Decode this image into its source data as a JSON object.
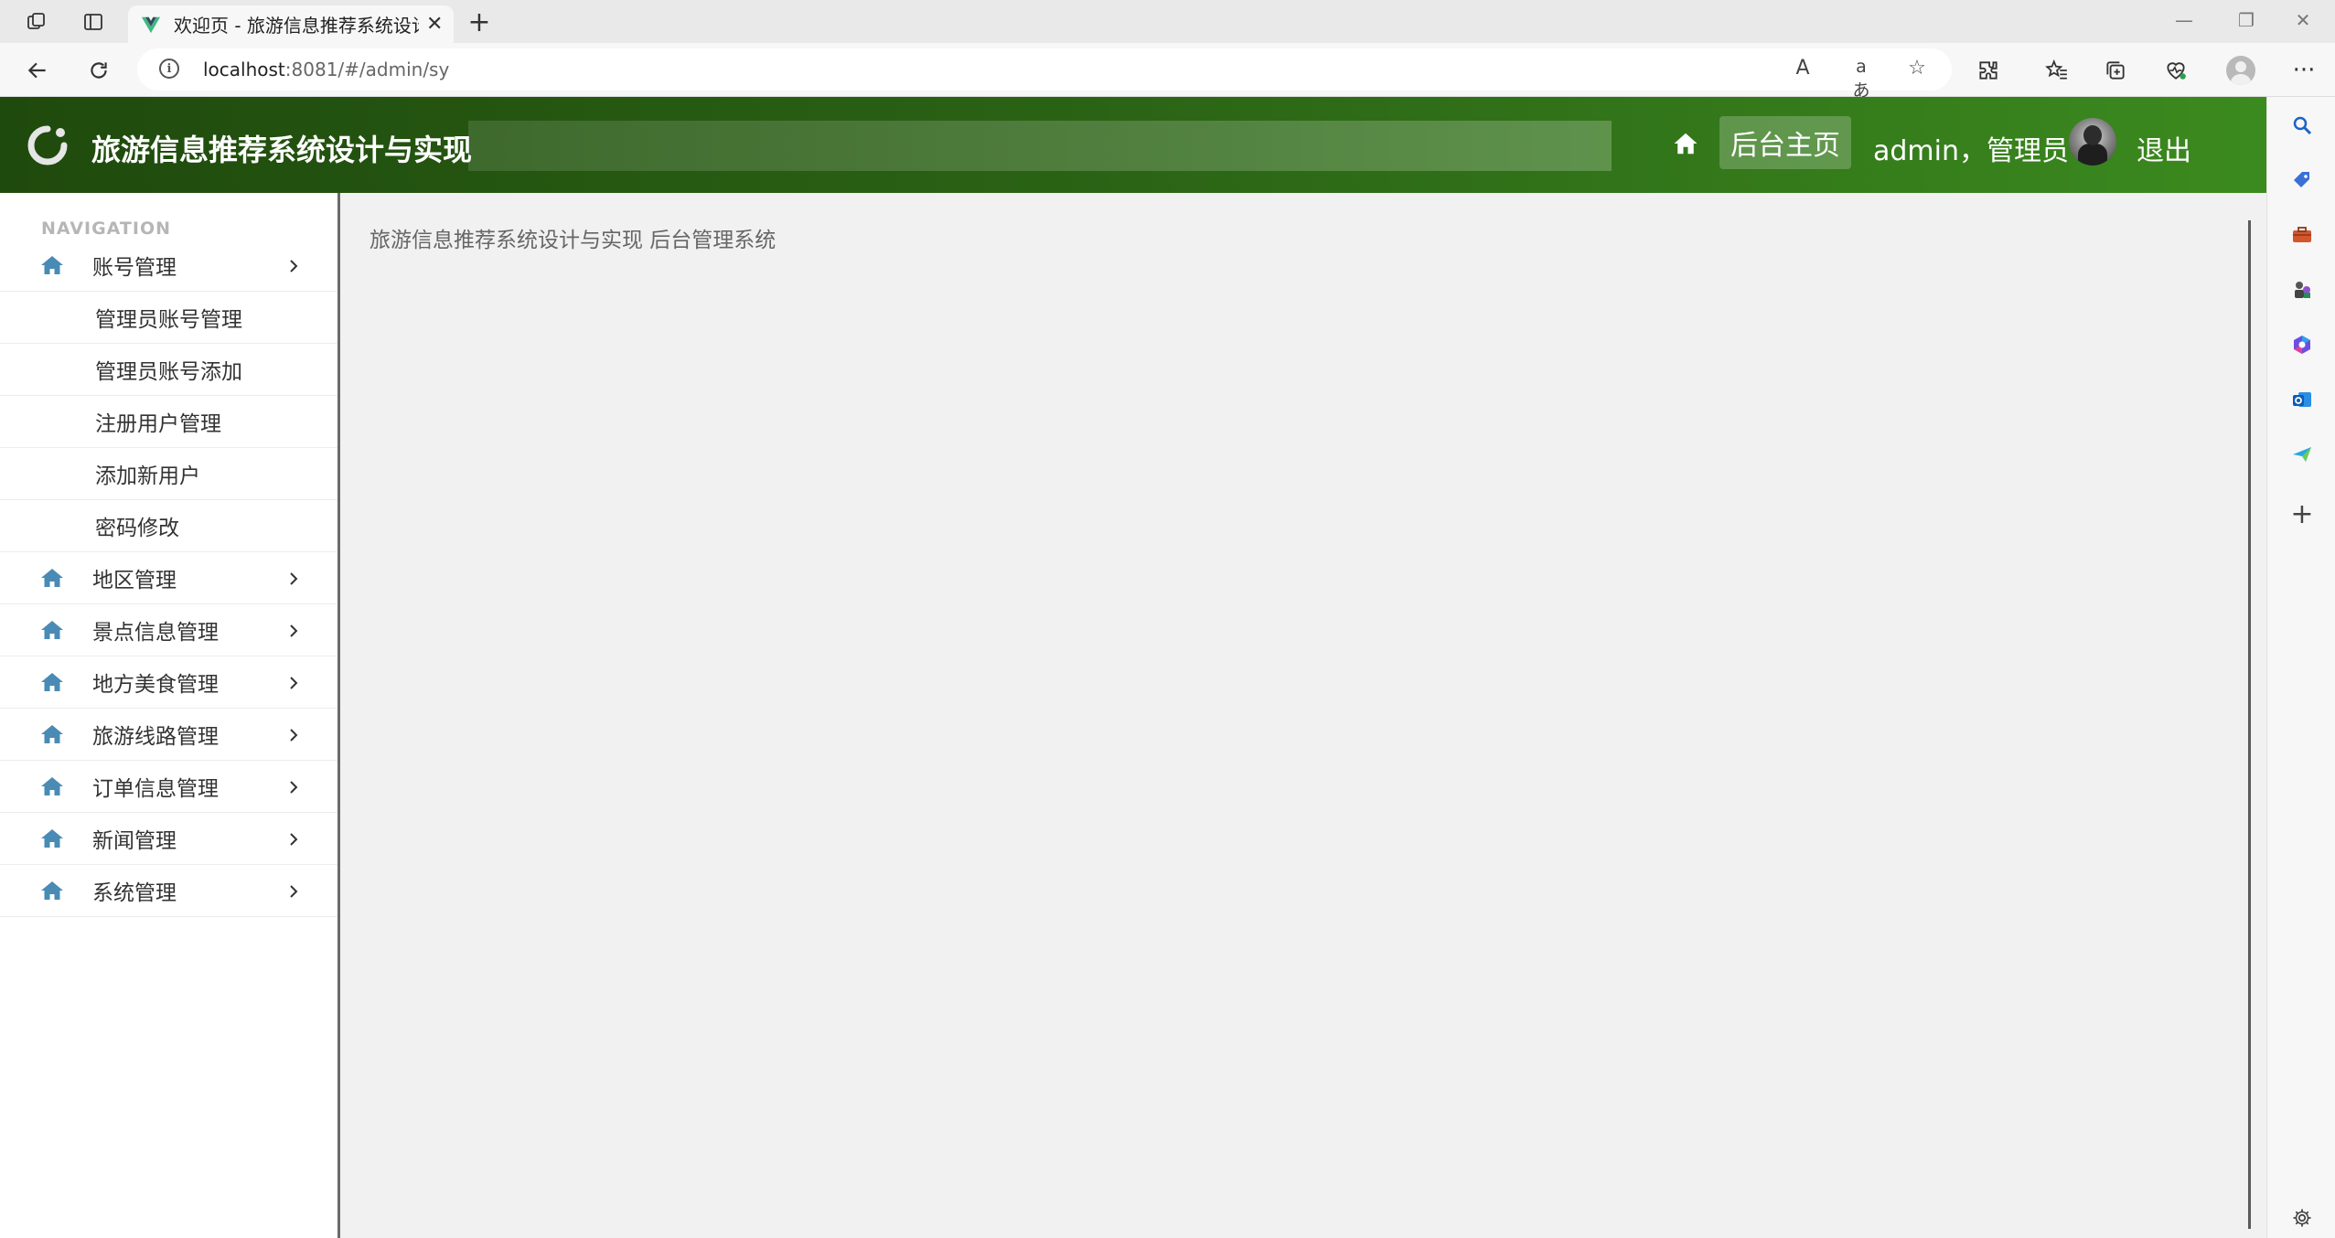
{
  "browser": {
    "tab_title": "欢迎页 - 旅游信息推荐系统设计与实现",
    "url_host": "localhost",
    "url_path": ":8081/#/admin/sy",
    "read_aloud_icon": "A",
    "translate_icon": "aあ"
  },
  "header": {
    "site_title": "旅游信息推荐系统设计与实现",
    "home_button": "后台主页",
    "user_label": "admin，管理员",
    "logout": "退出"
  },
  "sidebar": {
    "caption": "NAVIGATION",
    "menus": [
      {
        "label": "账号管理",
        "expanded": true,
        "children": [
          "管理员账号管理",
          "管理员账号添加",
          "注册用户管理",
          "添加新用户",
          "密码修改"
        ]
      },
      {
        "label": "地区管理"
      },
      {
        "label": "景点信息管理"
      },
      {
        "label": "地方美食管理"
      },
      {
        "label": "旅游线路管理"
      },
      {
        "label": "订单信息管理"
      },
      {
        "label": "新闻管理"
      },
      {
        "label": "系统管理"
      }
    ]
  },
  "content": {
    "welcome_text": "旅游信息推荐系统设计与实现 后台管理系统"
  },
  "colors": {
    "header_start": "#1f4a0d",
    "header_end": "#3b8a1f",
    "menu_icon": "#4a8bb5"
  }
}
